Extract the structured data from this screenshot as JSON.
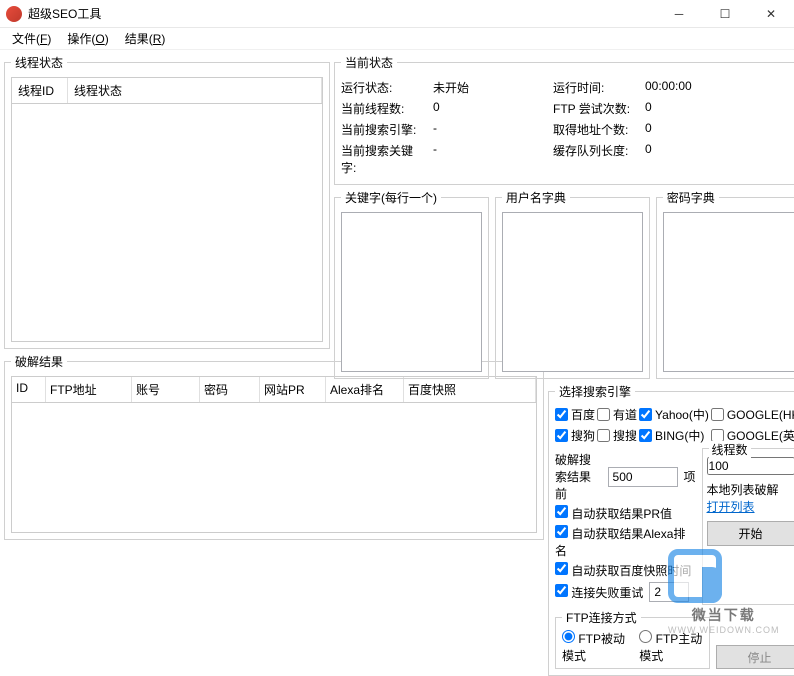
{
  "window": {
    "title": "超级SEO工具"
  },
  "menu": {
    "file": "文件",
    "file_u": "F",
    "op": "操作",
    "op_u": "O",
    "result": "结果",
    "result_u": "R"
  },
  "thread_panel": {
    "legend": "线程状态",
    "col_id": "线程ID",
    "col_status": "线程状态"
  },
  "crack_panel": {
    "legend": "破解结果",
    "cols": {
      "id": "ID",
      "ftp": "FTP地址",
      "user": "账号",
      "pass": "密码",
      "pr": "网站PR",
      "alexa": "Alexa排名",
      "baidu": "百度快照"
    }
  },
  "status": {
    "legend": "当前状态",
    "labels": {
      "run_state": "运行状态:",
      "run_time": "运行时间:",
      "threads": "当前线程数:",
      "ftp_try": "FTP 尝试次数:",
      "engine": "当前搜索引擎:",
      "got_addr": "取得地址个数:",
      "keyword": "当前搜索关键字:",
      "queue": "缓存队列长度:"
    },
    "values": {
      "run_state": "未开始",
      "run_time": "00:00:00",
      "threads": "0",
      "ftp_try": "0",
      "engine": "-",
      "got_addr": "0",
      "keyword": "-",
      "queue": "0"
    }
  },
  "dicts": {
    "keywords": "关键字(每行一个)",
    "users": "用户名字典",
    "passwords": "密码字典"
  },
  "engines": {
    "legend": "选择搜索引擎",
    "items": {
      "baidu": "百度",
      "youdao": "有道",
      "yahoo": "Yahoo(中)",
      "googlehk": "GOOGLE(HK)",
      "sogou": "搜狗",
      "soso": "搜搜",
      "bing": "BING(中)",
      "googleen": "GOOGLE(英)"
    },
    "checked": {
      "baidu": true,
      "youdao": false,
      "yahoo": true,
      "googlehk": false,
      "sogou": true,
      "soso": false,
      "bing": true,
      "googleen": false
    }
  },
  "options": {
    "crack_top_label": "破解搜索结果前",
    "crack_top_value": "500",
    "items_label": "项",
    "thread_group": "线程数",
    "thread_value": "100",
    "auto_pr": "自动获取结果PR值",
    "auto_alexa": "自动获取结果Alexa排名",
    "auto_baidu": "自动获取百度快照时间",
    "retry_label": "连接失败重试",
    "retry_value": "2",
    "local_crack": "本地列表破解",
    "open_list": "打开列表"
  },
  "ftp_mode": {
    "legend": "FTP连接方式",
    "passive": "FTP被动模式",
    "active": "FTP主动模式"
  },
  "buttons": {
    "start": "开始",
    "stop": "停止"
  },
  "watermark": {
    "line1": "微当下载",
    "line2": "WWW.WEIDOWN.COM"
  }
}
